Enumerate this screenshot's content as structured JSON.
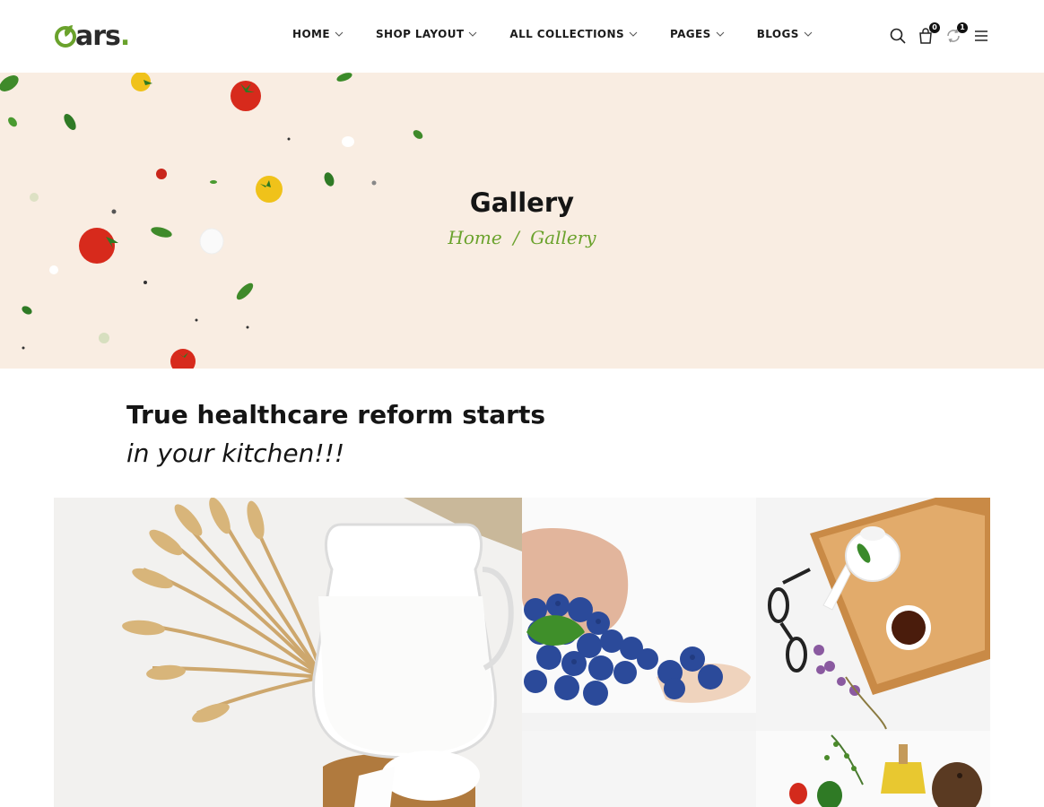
{
  "header": {
    "logo_text": "ars",
    "logo_dot": ".",
    "nav": [
      {
        "label": "HOME"
      },
      {
        "label": "SHOP LAYOUT"
      },
      {
        "label": "ALL COLLECTIONS"
      },
      {
        "label": "PAGES"
      },
      {
        "label": "BLOGS"
      }
    ],
    "cart_count": "0",
    "compare_count": "1"
  },
  "hero": {
    "title": "Gallery",
    "breadcrumb_home": "Home",
    "breadcrumb_sep": "/",
    "breadcrumb_current": "Gallery"
  },
  "intro": {
    "line1": "True healthcare reform starts",
    "line2": "in your kitchen!!!"
  },
  "gallery": {
    "images": [
      "milk-jug-wheat-photo",
      "blueberries-spoon-photo",
      "tea-tray-photo",
      "olive-oil-herbs-photo"
    ]
  },
  "colors": {
    "accent": "#6aa22c",
    "hero_bg": "#f9ede2",
    "text": "#151515"
  }
}
